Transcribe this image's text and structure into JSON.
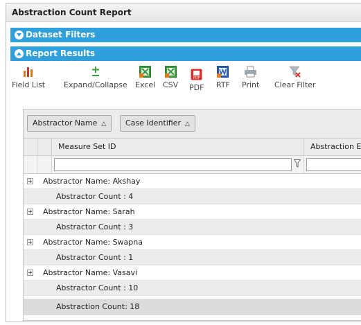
{
  "report": {
    "title": "Abstraction Count Report"
  },
  "sections": {
    "dataset_filters": "Dataset Filters",
    "report_results": "Report Results"
  },
  "toolbar": {
    "field_list": "Field List",
    "expand_collapse": "Expand/Collapse",
    "excel": "Excel",
    "csv": "CSV",
    "pdf": "PDF",
    "rtf": "RTF",
    "print": "Print",
    "clear_filter": "Clear Filter"
  },
  "grid": {
    "group_by": [
      "Abstractor Name",
      "Case Identifier"
    ],
    "columns": [
      "Measure Set ID",
      "Abstraction E"
    ],
    "groups": [
      {
        "header": "Abstractor Name: Akshay",
        "count": "Abstractor Count : 4"
      },
      {
        "header": "Abstractor Name: Sarah",
        "count": "Abstractor Count : 3"
      },
      {
        "header": "Abstractor Name: Swapna",
        "count": "Abstractor Count : 1"
      },
      {
        "header": "Abstractor Name: Vasavi",
        "count": "Abstractor Count : 10"
      }
    ],
    "total": "Abstraction Count: 18"
  },
  "colors": {
    "section_bar": "#2fa0dc",
    "excel_green": "#3a9b3a",
    "pdf_red": "#d9302c",
    "rtf_blue": "#2c5fb8"
  }
}
